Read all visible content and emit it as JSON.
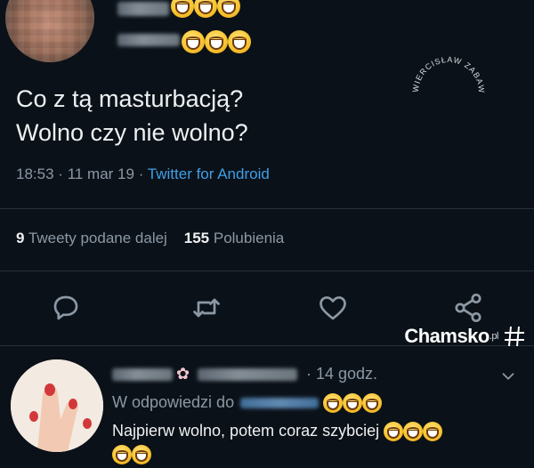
{
  "tweet": {
    "text": "Co z tą masturbacją?\nWolno czy nie wolno?",
    "time": "18:53",
    "sep1": "·",
    "date": "11 mar 19",
    "sep2": "·",
    "client": "Twitter for Android"
  },
  "stats": {
    "retweets_count": "9",
    "retweets_label": "Tweety podane dalej",
    "likes_count": "155",
    "likes_label": "Polubienia"
  },
  "watermark": {
    "text": "WIERCISŁAW ZABAWNY"
  },
  "brand": {
    "name": "Chamsko",
    "tld": ".pl",
    "mark": "#"
  },
  "reply": {
    "time": "· 14 godz.",
    "in_reply_to": "W odpowiedzi do",
    "text": "Najpierw wolno,  potem coraz szybciej"
  },
  "icons": {
    "reply": "reply-icon",
    "retweet": "retweet-icon",
    "like": "heart-icon",
    "share": "share-icon",
    "more": "chevron-down-icon"
  },
  "colors": {
    "background": "#0b1118",
    "link": "#3f9fe6",
    "muted": "#8b98a5",
    "text": "#eef1f3"
  }
}
